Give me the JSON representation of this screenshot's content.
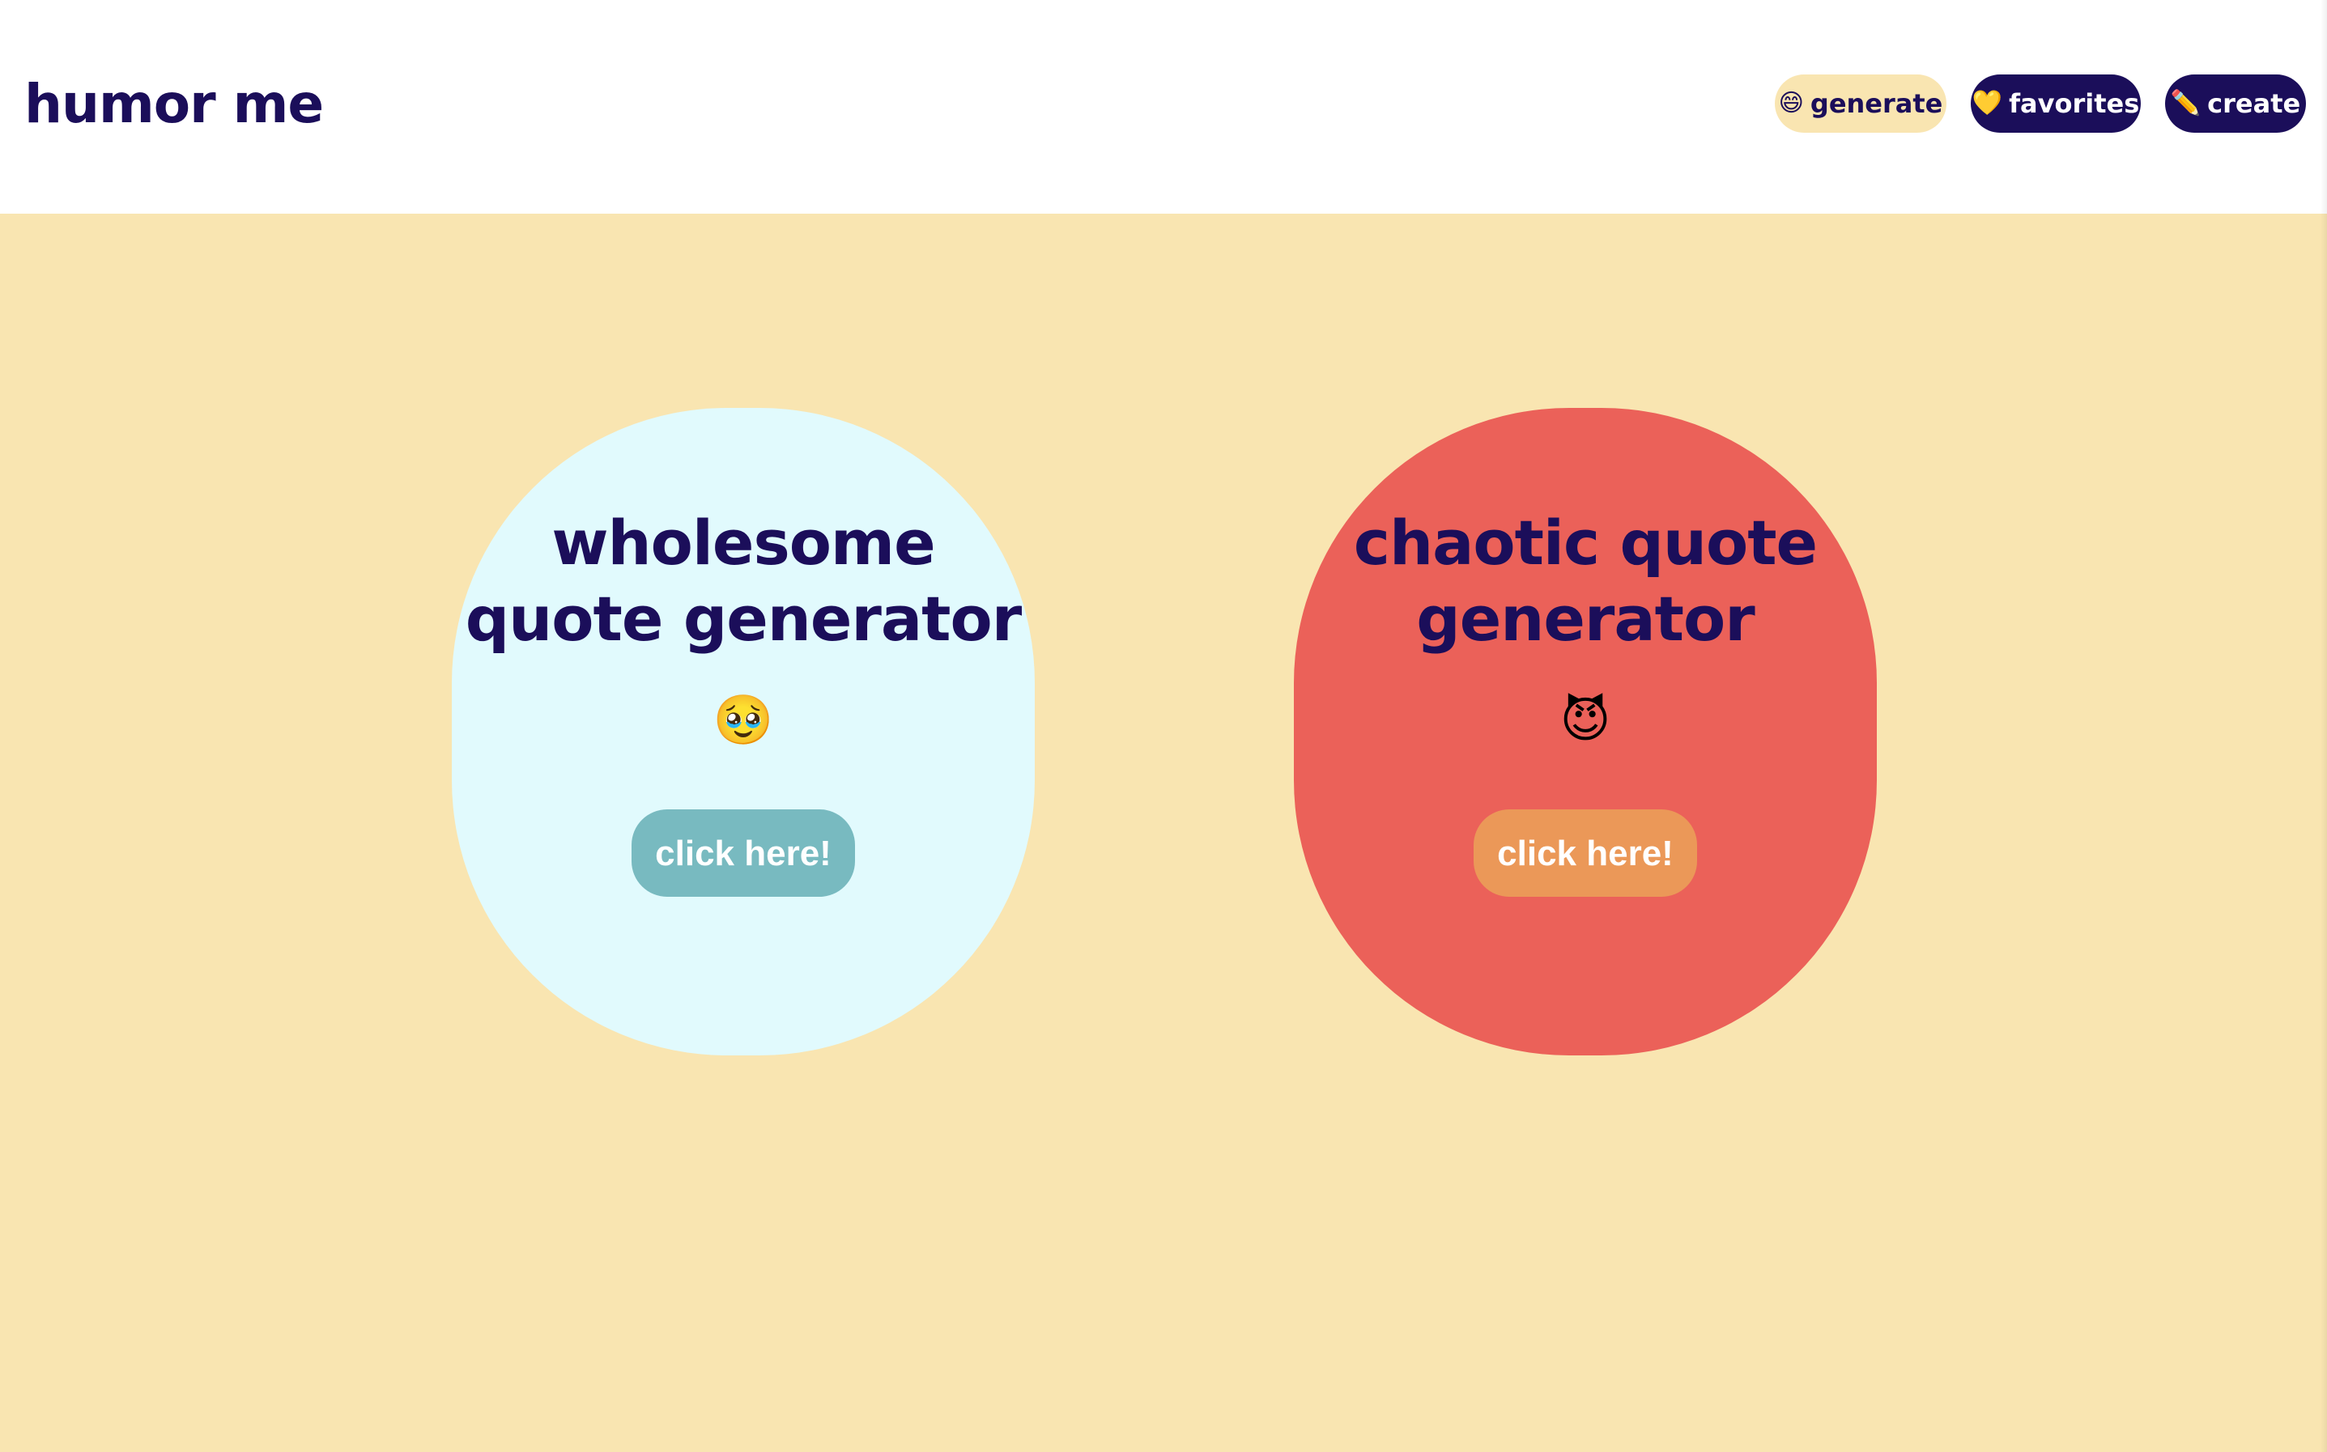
{
  "header": {
    "brand": "humor me",
    "nav": [
      {
        "icon": "😄",
        "label": "generate"
      },
      {
        "icon": "💛",
        "label": "favorites"
      },
      {
        "icon": "✏️",
        "label": "create"
      }
    ]
  },
  "cards": [
    {
      "title_line1": "wholesome",
      "title_line2": "quote generator",
      "emoji": "🥹",
      "button": "click here!"
    },
    {
      "title_line1": "chaotic quote",
      "title_line2": "generator",
      "emoji": "😈",
      "button": "click here!"
    }
  ],
  "colors": {
    "navy": "#1b0e5a",
    "page_background": "#f9e5b1",
    "wholesome_card": "#e1fafd",
    "wholesome_button": "#78bac0",
    "chaotic_card": "#eb6159",
    "chaotic_button": "#eb9858"
  }
}
